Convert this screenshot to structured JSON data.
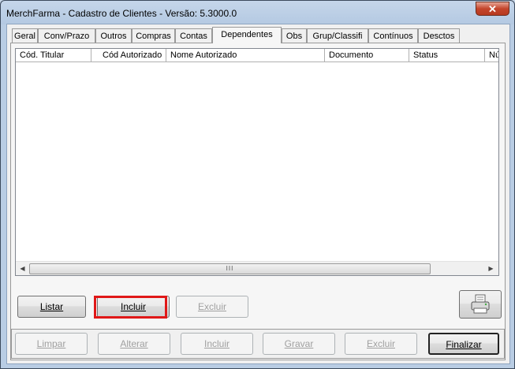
{
  "window": {
    "title": "MerchFarma - Cadastro de Clientes - Versão: 5.3000.0",
    "close_label": "✕"
  },
  "tabs": [
    {
      "label": "Geral",
      "active": false
    },
    {
      "label": "Conv/Prazo",
      "active": false
    },
    {
      "label": "Outros",
      "active": false
    },
    {
      "label": "Compras",
      "active": false
    },
    {
      "label": "Contas",
      "active": false
    },
    {
      "label": "Dependentes",
      "active": true
    },
    {
      "label": "Obs",
      "active": false
    },
    {
      "label": "Grup/Classifi",
      "active": false
    },
    {
      "label": "Contínuos",
      "active": false
    },
    {
      "label": "Desctos",
      "active": false
    }
  ],
  "grid": {
    "columns": [
      "Cód. Titular",
      "Cód Autorizado",
      "Nome Autorizado",
      "Documento",
      "Status",
      "Nú"
    ],
    "rows": [],
    "scroll_thumb_grip": "III"
  },
  "actions": {
    "listar": "Listar",
    "incluir": "Incluir",
    "excluir": "Excluir",
    "printer_icon": "printer-icon"
  },
  "footer": {
    "limpar": "Limpar",
    "alterar": "Alterar",
    "incluir": "Incluir",
    "gravar": "Gravar",
    "excluir": "Excluir",
    "finalizar": "Finalizar"
  },
  "colors": {
    "highlight": "#e01818",
    "title_bar": "#b9cde4"
  }
}
